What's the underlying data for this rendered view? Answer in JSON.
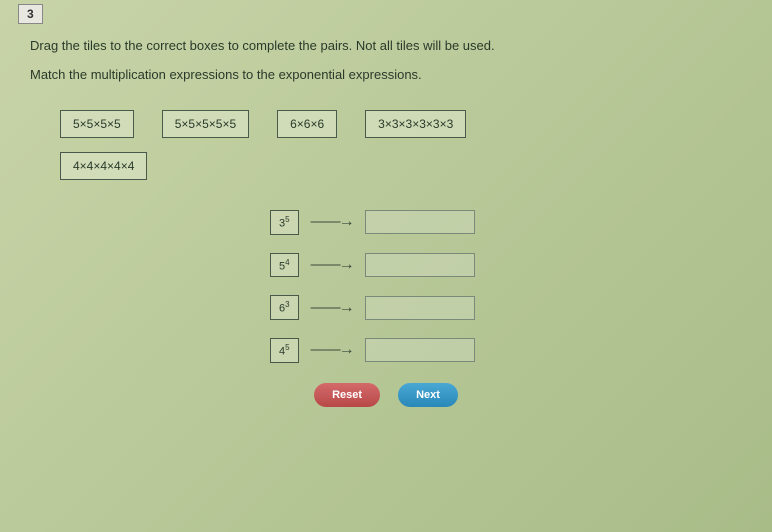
{
  "question_number": "3",
  "instruction1": "Drag the tiles to the correct boxes to complete the pairs. Not all tiles will be used.",
  "instruction2": "Match the multiplication expressions to the exponential expressions.",
  "tiles": {
    "t1": "5×5×5×5",
    "t2": "5×5×5×5×5",
    "t3": "6×6×6",
    "t4": "3×3×3×3×3×3",
    "t5": "4×4×4×4×4"
  },
  "exponents": {
    "e1_base": "3",
    "e1_exp": "5",
    "e2_base": "5",
    "e2_exp": "4",
    "e3_base": "6",
    "e3_exp": "3",
    "e4_base": "4",
    "e4_exp": "5"
  },
  "buttons": {
    "reset": "Reset",
    "next": "Next"
  }
}
